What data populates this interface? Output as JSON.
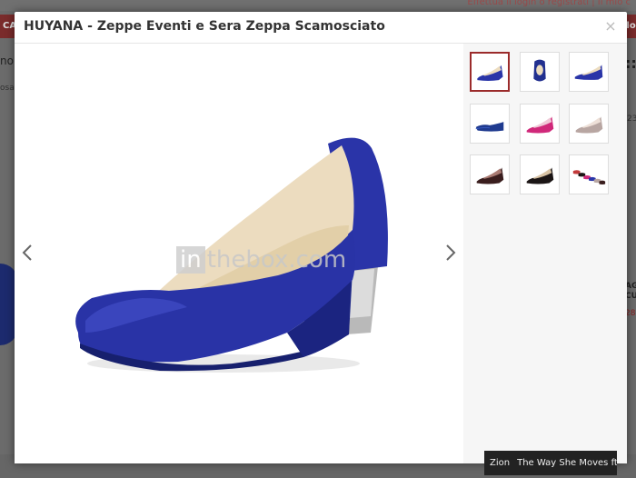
{
  "modal": {
    "title": "HUYANA - Zeppe Eventi e Sera Zeppa Scamosciato",
    "close_label": "×"
  },
  "viewer": {
    "watermark_box": "in",
    "watermark_text": "thebox.com",
    "prev_icon": "chevron-left-icon",
    "next_icon": "chevron-right-icon"
  },
  "thumbnails": [
    {
      "color": "#2a35a8",
      "icon": "blue-wedge-side-icon",
      "active": true
    },
    {
      "color": "#22308f",
      "icon": "blue-wedge-front-icon",
      "active": false
    },
    {
      "color": "#2a35a8",
      "icon": "blue-wedge-side-icon",
      "active": false
    },
    {
      "color": "#1f3a8f",
      "icon": "navy-wedge-icon",
      "active": false
    },
    {
      "color": "#d0287a",
      "icon": "pink-wedge-icon",
      "active": false
    },
    {
      "color": "#b8a6a2",
      "icon": "grey-wedge-icon",
      "active": false
    },
    {
      "color": "#3a1e1e",
      "icon": "black-wedge-icon",
      "active": false
    },
    {
      "color": "#1b1515",
      "icon": "black-wedge-icon",
      "active": false
    },
    {
      "color": "#c23a3a",
      "icon": "color-range-icon",
      "active": false
    }
  ],
  "tooltip": {
    "artist": "Zion",
    "track": "The Way She Moves ft A..."
  },
  "background": {
    "top_links": "Effettua il login o registrati  |  Il mio c",
    "left_tab": "CA",
    "right_tab": "llo",
    "left_text1": "no",
    "left_text2": "osa",
    "right_text1": "::",
    "right_text2": "23",
    "right_text3a": "AG",
    "right_text3b": "CU",
    "right_text4": "28"
  }
}
